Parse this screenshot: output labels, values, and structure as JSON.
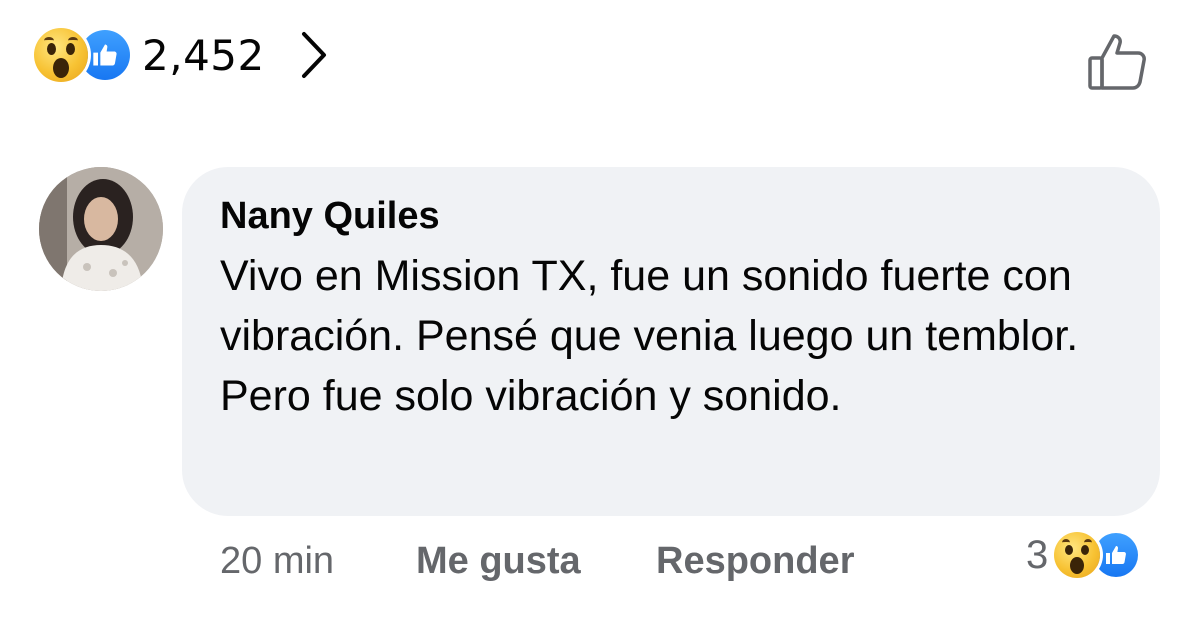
{
  "post_reactions": {
    "icons": [
      "wow-emoji",
      "like-emoji"
    ],
    "count": "2,452"
  },
  "comment": {
    "author": "Nany Quiles",
    "text": "Vivo en Mission TX, fue un sonido fuerte con vibración. Pensé que venia luego un temblor. Pero fue solo vibración y sonido.",
    "time": "20 min",
    "like_label": "Me gusta",
    "reply_label": "Responder",
    "reaction_count": "3",
    "reaction_icons": [
      "wow-emoji",
      "like-emoji"
    ]
  },
  "colors": {
    "like_blue": "#1877f2",
    "bubble_bg": "#f0f2f5",
    "secondary_text": "#65676b"
  }
}
